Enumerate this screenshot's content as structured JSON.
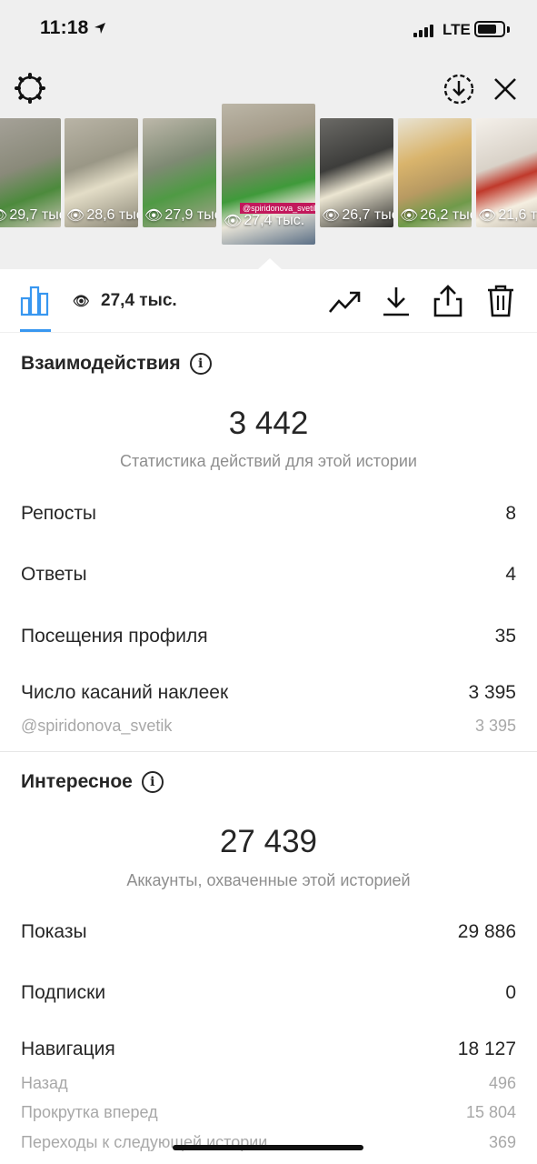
{
  "status_bar": {
    "time": "11:18",
    "network": "LTE"
  },
  "top_bar": {
    "settings_icon": "gear-icon",
    "download_icon": "download-circle-icon",
    "close_icon": "close-icon"
  },
  "stories": [
    {
      "views": "29,7 тыс",
      "color": "#8a8a7a"
    },
    {
      "views": "28,6 тыс",
      "color": "#9a9786"
    },
    {
      "views": "27,9 тыс",
      "color": "#7f8a74"
    },
    {
      "views": "27,4 тыс.",
      "color": "#6f8a5e",
      "handle": "@spiridonova_svetik"
    },
    {
      "views": "26,7 тыс",
      "color": "#3d3d3b"
    },
    {
      "views": "26,2 тыс",
      "color": "#b89a62"
    },
    {
      "views": "21,6 т",
      "color": "#d9d2c8"
    }
  ],
  "toolbar": {
    "views": "27,4 тыс."
  },
  "interactions": {
    "title": "Взаимодействия",
    "total": "3 442",
    "caption": "Статистика действий для этой истории",
    "rows": [
      {
        "label": "Репосты",
        "value": "8"
      },
      {
        "label": "Ответы",
        "value": "4"
      },
      {
        "label": "Посещения профиля",
        "value": "35"
      },
      {
        "label": "Число касаний наклеек",
        "value": "3 395"
      }
    ],
    "sub_rows": [
      {
        "label": "@spiridonova_svetik",
        "value": "3 395"
      }
    ]
  },
  "discovery": {
    "title": "Интересное",
    "total": "27 439",
    "caption": "Аккаунты, охваченные этой историей",
    "rows": [
      {
        "label": "Показы",
        "value": "29 886"
      },
      {
        "label": "Подписки",
        "value": "0"
      },
      {
        "label": "Навигация",
        "value": "18 127"
      }
    ],
    "sub_rows": [
      {
        "label": "Назад",
        "value": "496"
      },
      {
        "label": "Прокрутка вперед",
        "value": "15 804"
      },
      {
        "label": "Переходы к следующей истории",
        "value": "369"
      }
    ]
  },
  "colors": {
    "accent": "#3897f0",
    "text": "#262626",
    "muted": "#8e8e8e",
    "top_bg": "#efefef"
  }
}
